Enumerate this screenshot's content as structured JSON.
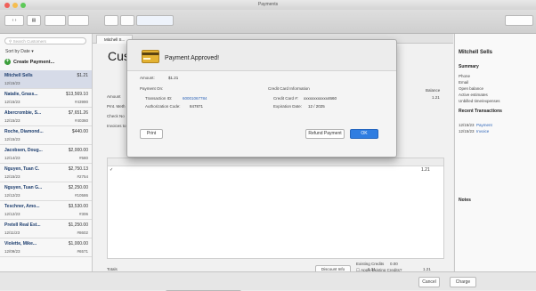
{
  "window": {
    "title": "Payments"
  },
  "search": {
    "placeholder": "Search Customers"
  },
  "sort": {
    "label": "Sort by Date"
  },
  "create_payment": {
    "label": "Create Payment..."
  },
  "customers": [
    {
      "name": "Mitchell Sells",
      "amount": "$1.21",
      "date": "12/15/23",
      "num": ""
    },
    {
      "name": "Natalie, Grass...",
      "amount": "$13,569.10",
      "date": "12/15/23",
      "num": "#43990"
    },
    {
      "name": "Abercrombie, S...",
      "amount": "$7,651.26",
      "date": "12/15/23",
      "num": "#40360"
    },
    {
      "name": "Roche, Diamond...",
      "amount": "$440.00",
      "date": "12/15/23",
      "num": ""
    },
    {
      "name": "Jacobsen, Doug...",
      "amount": "$2,000.00",
      "date": "12/14/23",
      "num": "#580"
    },
    {
      "name": "Nguyen, Tuan C.",
      "amount": "$2,750.13",
      "date": "12/15/23",
      "num": "#2754"
    },
    {
      "name": "Nguyen, Tuan G...",
      "amount": "$2,250.00",
      "date": "12/12/23",
      "num": "#10586"
    },
    {
      "name": "Teschner, Amo...",
      "amount": "$3,530.00",
      "date": "12/12/23",
      "num": "#306"
    },
    {
      "name": "Pretell Real Est...",
      "amount": "$1,250.00",
      "date": "12/11/23",
      "num": "#8602"
    },
    {
      "name": "Violette, Mike...",
      "amount": "$1,000.00",
      "date": "12/09/23",
      "num": "#6571"
    }
  ],
  "center": {
    "tab_label": "Mitchell S...",
    "customer_title": "Custc",
    "amount_label": "Amount",
    "pmt_method_label": "Pmt. Meth",
    "check_label": "Check No",
    "invoices_label": "Invoices to",
    "balance_label": "Balance",
    "balance_value": "1.21",
    "row_amount": "1.21",
    "totals_label": "Totals",
    "totals_left": "1.21",
    "totals_right": "1.21",
    "deposit_label": "Deposit",
    "group_label": "Group with other undeposited funds",
    "deposit_to_label": "Deposit to",
    "deposit_to_value": "1030 · Checking",
    "discount_btn": "Discount Info",
    "clear_btn": "Clear Payments",
    "existing_credits_label": "Existing Credits",
    "existing_credits_value": "0.00",
    "apply_credits_label": "Apply Existing Credits?",
    "total_apply_label": "Total to Apply",
    "total_apply_value": "1.21",
    "unapplied_label": "Unapplied Amount",
    "unapplied_value": "0.00"
  },
  "bottom": {
    "cancel": "Cancel",
    "charge": "Charge"
  },
  "right": {
    "customer": "Mitchell Sells",
    "summary": "Summary",
    "phone": "Phone",
    "email": "Email",
    "open_balance": "Open balance",
    "active_estimates": "Active estimates",
    "unbilled": "Unbilled time/expenses",
    "recent": "Recent Transactions",
    "tx1_date": "12/15/23",
    "tx1_type": "Payment",
    "tx2_date": "12/15/23",
    "tx2_type": "Invoice",
    "notes": "Notes"
  },
  "dialog": {
    "title": "Payment Approved!",
    "amount_label": "Amount:",
    "amount_value": "$1.21",
    "payment_on": "Payment On:",
    "transaction_id_label": "Transaction ID:",
    "transaction_id_value": "60001067784",
    "auth_code_label": "Authorization Code:",
    "auth_code_value": "847871",
    "cc_info": "Credit Card Information",
    "cc_num_label": "Credit Card #:",
    "cc_num_value": "xxxxxxxxxxxx4660",
    "exp_label": "Expiration Date:",
    "exp_value": "12 / 2025",
    "print_btn": "Print",
    "refund_btn": "Refund Payment",
    "ok_btn": "OK"
  },
  "colors": {
    "accent": "#2f7de1",
    "selected_row": "#d6dbe8",
    "icon_card": "#e3b232"
  }
}
